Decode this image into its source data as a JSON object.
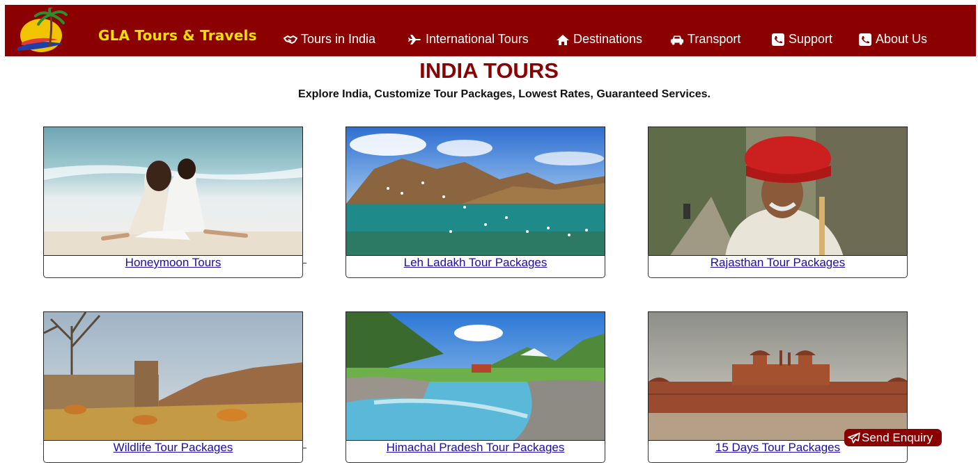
{
  "brand": {
    "name": "GLA Tours & Travels",
    "logo_icon": "palm-island-logo"
  },
  "nav": [
    {
      "label": "Tours in India",
      "icon": "handshake-icon"
    },
    {
      "label": "International Tours",
      "icon": "airplane-icon"
    },
    {
      "label": "Destinations",
      "icon": "home-icon"
    },
    {
      "label": "Transport",
      "icon": "car-icon"
    },
    {
      "label": "Support",
      "icon": "phone-icon"
    },
    {
      "label": "About Us",
      "icon": "phone-icon"
    }
  ],
  "page": {
    "title": "INDIA TOURS",
    "subtitle": "Explore India, Customize Tour Packages, Lowest Rates, Guaranteed Services."
  },
  "cards": [
    {
      "label": "Honeymoon Tours"
    },
    {
      "label": "Leh Ladakh Tour Packages"
    },
    {
      "label": "Rajasthan Tour Packages"
    },
    {
      "label": "Wildlife Tour Packages"
    },
    {
      "label": "Himachal Pradesh Tour Packages"
    },
    {
      "label": "15 Days Tour Packages"
    }
  ],
  "enquiry": {
    "label": "Send Enquiry",
    "icon": "paper-plane-icon"
  },
  "colors": {
    "nav_bg": "#8b0000",
    "brand": "#f5e000",
    "title": "#8b0000",
    "link": "#1a0dab"
  }
}
